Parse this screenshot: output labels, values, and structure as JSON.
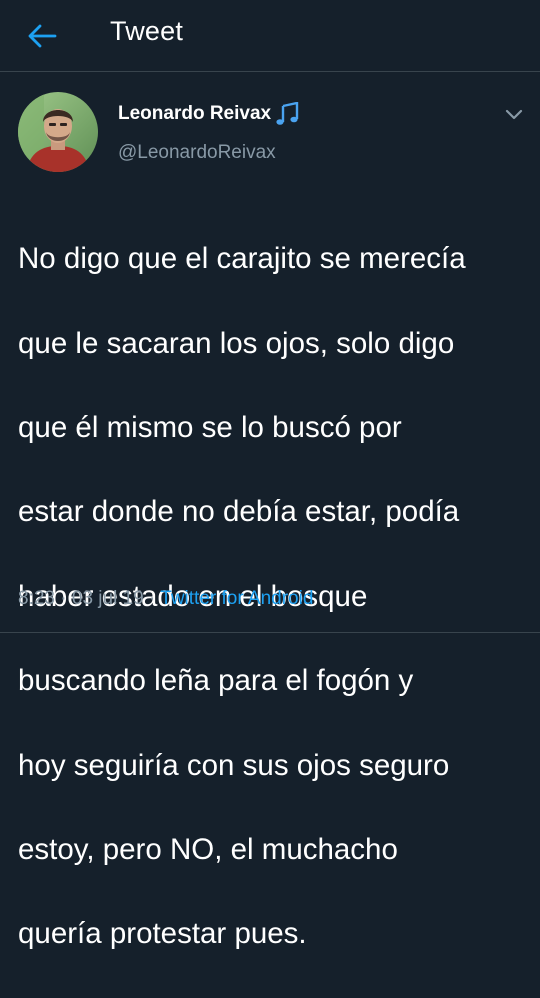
{
  "header": {
    "title": "Tweet",
    "back_icon": "arrow-left-icon"
  },
  "colors": {
    "background": "#15202b",
    "accent": "#1da1f2",
    "muted_text": "#8899a6",
    "divider": "#38444d"
  },
  "tweet": {
    "author": {
      "name": "Leonardo Reivax",
      "name_emoji": "music-notes-icon",
      "handle": "@LeonardoReivax"
    },
    "text_lines": [
      "No digo que el carajito se merecía",
      "que le sacaran los ojos, solo digo",
      "que él mismo se lo buscó por",
      "estar donde no debía estar, podía",
      "haber estado en el bosque",
      "buscando leña para el fogón y",
      "hoy seguiría con sus ojos seguro",
      "estoy, pero NO, el muchacho",
      "quería protestar pues."
    ],
    "time": "8:23",
    "date": "03 jul 19",
    "separator": "·",
    "source": "Twitter for Android"
  }
}
